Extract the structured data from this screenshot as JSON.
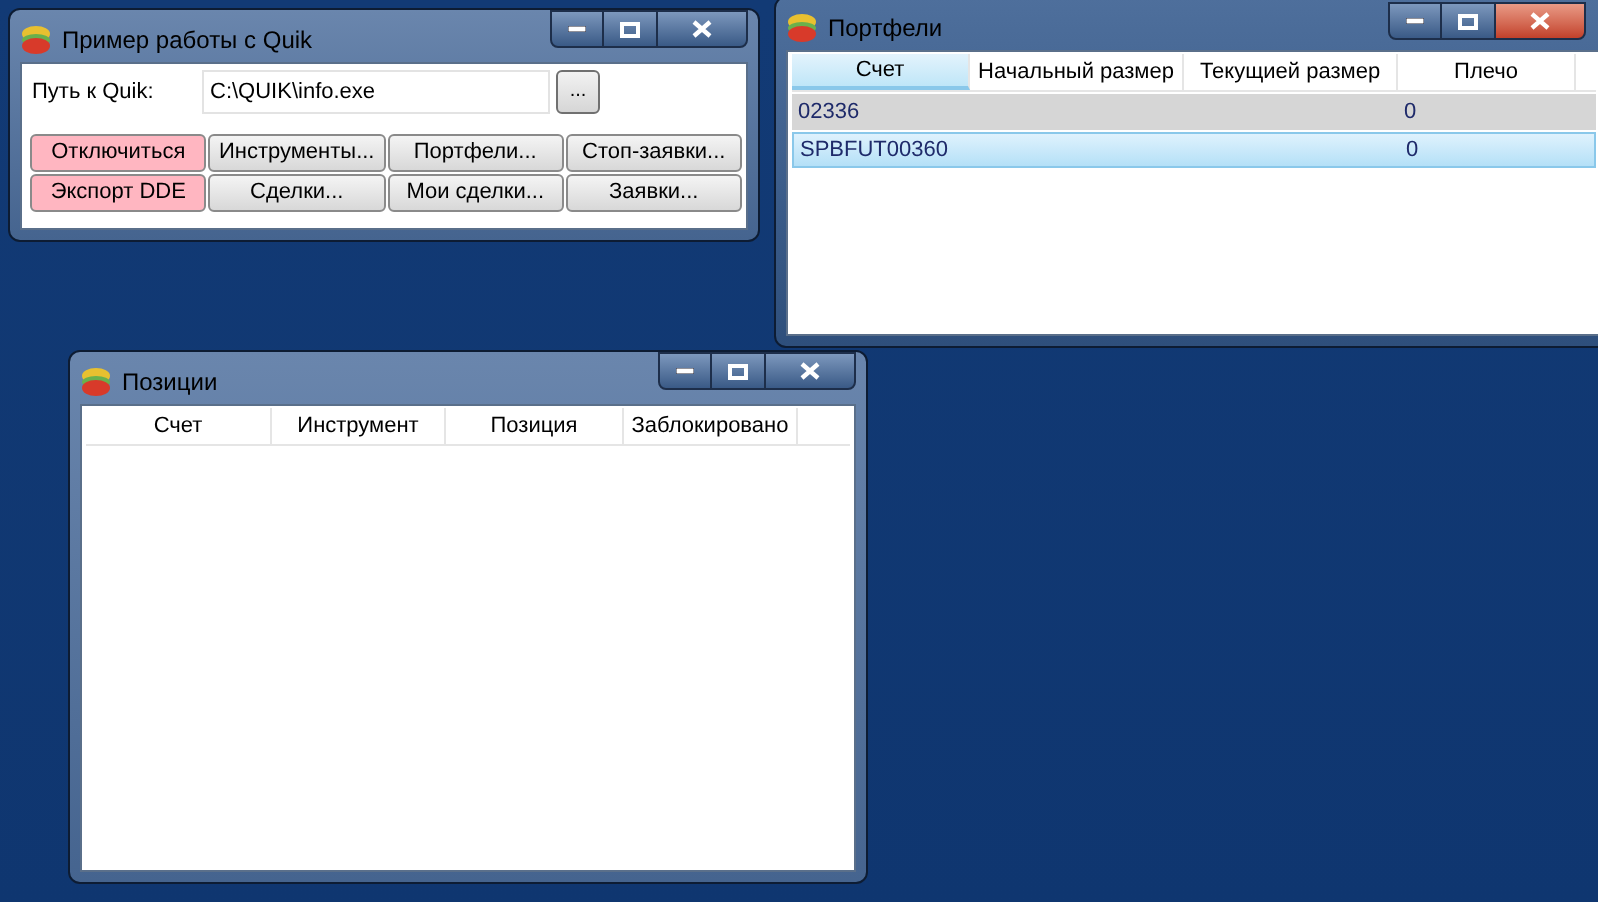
{
  "windows": [
    {
      "kind": "main",
      "title": "Пример работы с Quik",
      "active": false,
      "path_label": "Путь к Quik:",
      "path_value": "C:\\QUIK\\info.exe",
      "browse_button": "...",
      "buttons": [
        {
          "label": "Отключиться",
          "highlighted": true
        },
        {
          "label": "Инструменты...",
          "highlighted": false
        },
        {
          "label": "Портфели...",
          "highlighted": false
        },
        {
          "label": "Стоп-заявки...",
          "highlighted": false
        },
        {
          "label": "Экспорт DDE",
          "highlighted": true
        },
        {
          "label": "Сделки...",
          "highlighted": false
        },
        {
          "label": "Мои сделки...",
          "highlighted": false
        },
        {
          "label": "Заявки...",
          "highlighted": false
        }
      ]
    },
    {
      "kind": "table",
      "title": "Портфели",
      "active": true,
      "columns": [
        {
          "label": "Счет",
          "sorted": true
        },
        {
          "label": "Начальный размер",
          "sorted": false
        },
        {
          "label": "Текущией размер",
          "sorted": false
        },
        {
          "label": "Плечо",
          "sorted": false
        }
      ],
      "rows": [
        {
          "selected": false,
          "cells": [
            "02336",
            "",
            "",
            "0"
          ]
        },
        {
          "selected": true,
          "cells": [
            "SPBFUT00360",
            "",
            "",
            "0"
          ]
        }
      ]
    },
    {
      "kind": "table",
      "title": "Позиции",
      "active": false,
      "columns": [
        {
          "label": "Счет",
          "sorted": false
        },
        {
          "label": "Инструмент",
          "sorted": false
        },
        {
          "label": "Позиция",
          "sorted": false
        },
        {
          "label": "Заблокировано",
          "sorted": false
        }
      ]
    }
  ]
}
